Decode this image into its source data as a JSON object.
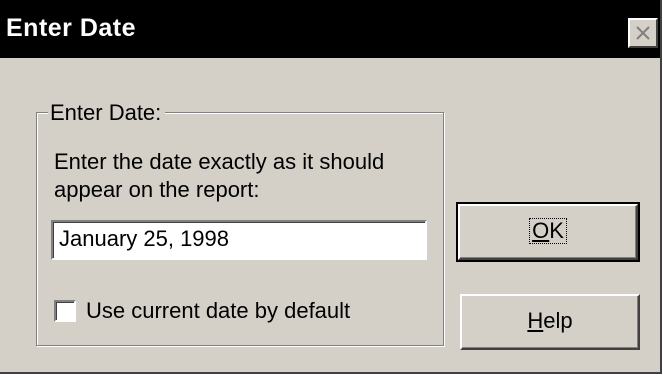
{
  "window": {
    "title": "Enter Date",
    "close_icon": "close-icon"
  },
  "group": {
    "label": "Enter Date:",
    "instructions": "Enter the date exactly as it should appear on the report:"
  },
  "date_field": {
    "value": "January 25, 1998"
  },
  "checkbox": {
    "label": "Use current date by default",
    "checked": false
  },
  "buttons": {
    "ok": {
      "mnemonic": "O",
      "rest": "K"
    },
    "help": {
      "mnemonic": "H",
      "rest": "elp"
    }
  }
}
